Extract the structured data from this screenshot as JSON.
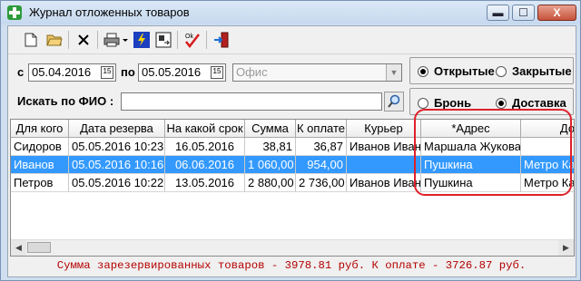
{
  "window": {
    "title": "Журнал отложенных товаров",
    "minimize_label": "▬",
    "maximize_label": "☐",
    "close_label": "X"
  },
  "toolbar": {
    "items": [
      "new-document-icon",
      "open-folder-icon",
      "delete-icon",
      "print-icon",
      "lightning-icon",
      "export-icon",
      "ok-check-icon",
      "exit-icon"
    ]
  },
  "filters": {
    "from_label": "с",
    "from_date": "05.04.2016",
    "to_label": "по",
    "to_date": "05.05.2016",
    "calendar_label": "15",
    "office_placeholder": "Офис",
    "search_label": "Искать по ФИО :",
    "search_value": ""
  },
  "status_group": {
    "open_label": "Открытые",
    "closed_label": "Закрытые",
    "selected": "Открытые"
  },
  "type_group": {
    "booking_label": "Бронь",
    "delivery_label": "Доставка",
    "selected": "Доставка"
  },
  "table": {
    "columns": [
      "Для кого",
      "Дата резерва",
      "На какой срок",
      "Сумма",
      "К оплате",
      "Курьер",
      "*Адрес",
      "Доп"
    ],
    "rows": [
      {
        "for_whom": "Сидоров",
        "reserve_date": "05.05.2016 10:23",
        "term": "16.05.2016",
        "sum": "38,81",
        "to_pay": "36,87",
        "courier": "Иванов Иван",
        "address": "Маршала Жукова",
        "extra": ""
      },
      {
        "for_whom": "Иванов",
        "reserve_date": "05.05.2016 10:16",
        "term": "06.06.2016",
        "sum": "1 060,00",
        "to_pay": "954,00",
        "courier": "",
        "address": "Пушкина",
        "extra": "Метро Ка"
      },
      {
        "for_whom": "Петров",
        "reserve_date": "05.05.2016 10:22",
        "term": "13.05.2016",
        "sum": "2 880,00",
        "to_pay": "2 736,00",
        "courier": "Иванов Иван",
        "address": "Пушкина",
        "extra": "Метро Ка"
      }
    ],
    "selected_row": 1
  },
  "footer": {
    "summary": "Сумма зарезервированных товаров - 3978.81 руб. К оплате - 3726.87 руб."
  },
  "colors": {
    "selection": "#3399ff",
    "summary_text": "#b50000",
    "annotation": "#e0202a"
  }
}
